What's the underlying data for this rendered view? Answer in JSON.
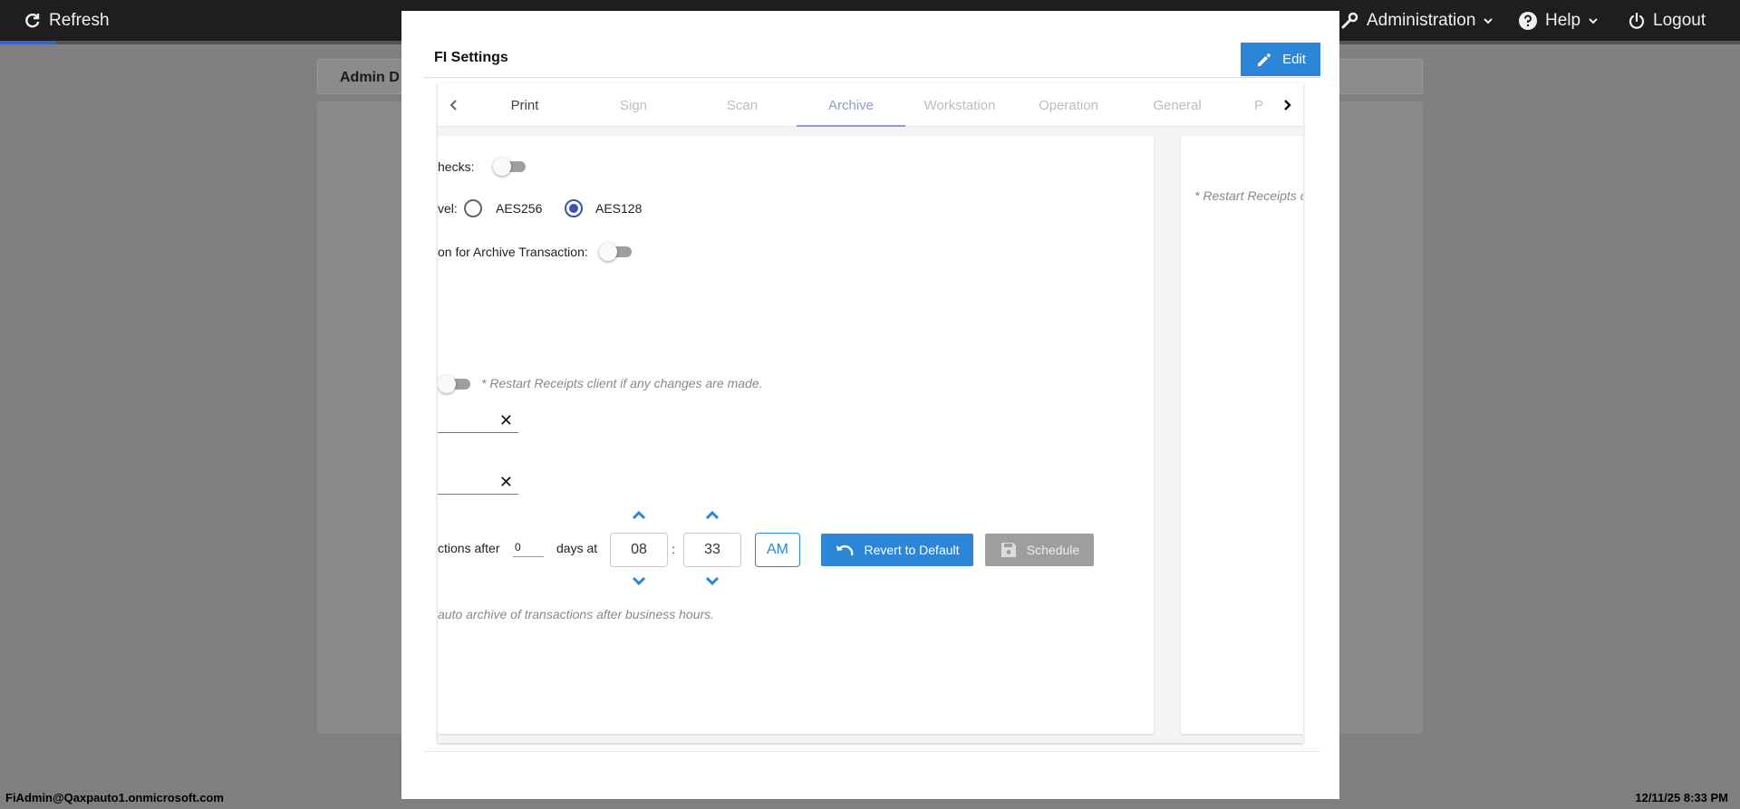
{
  "topbar": {
    "refresh_label": "Refresh",
    "administration_label": "Administration",
    "help_label": "Help",
    "logout_label": "Logout"
  },
  "background": {
    "header_title": "Admin D"
  },
  "statusbar": {
    "user": "FiAdmin@Qaxpauto1.onmicrosoft.com",
    "datetime": "12/11/25 8:33 PM"
  },
  "modal": {
    "title": "FI Settings",
    "edit_label": "Edit"
  },
  "tabs": [
    {
      "label": "Print"
    },
    {
      "label": "Sign"
    },
    {
      "label": "Scan"
    },
    {
      "label": "Archive"
    },
    {
      "label": "Workstation"
    },
    {
      "label": "Operation"
    },
    {
      "label": "General"
    },
    {
      "label": "P"
    }
  ],
  "archive": {
    "checks_label": "hecks:",
    "level_label": "vel:",
    "aes256_label": "AES256",
    "aes128_label": "AES128",
    "selected_level": "AES128",
    "archive_transaction_label": "on for Archive Transaction:",
    "restart_note": "* Restart Receipts client if any changes are made.",
    "transactions_after_label": "ctions after",
    "days_value": "0",
    "days_at_label": "days at",
    "hour": "08",
    "time_sep": ":",
    "minute": "33",
    "ampm": "AM",
    "revert_label": "Revert to Default",
    "schedule_label": "Schedule",
    "auto_archive_note": "auto archive of transactions after business hours."
  },
  "side": {
    "restart_note": "* Restart Receipts c"
  },
  "colors": {
    "accent": "#2c86d8",
    "radio": "#3f51b5",
    "topbar": "#1e1e1e"
  }
}
